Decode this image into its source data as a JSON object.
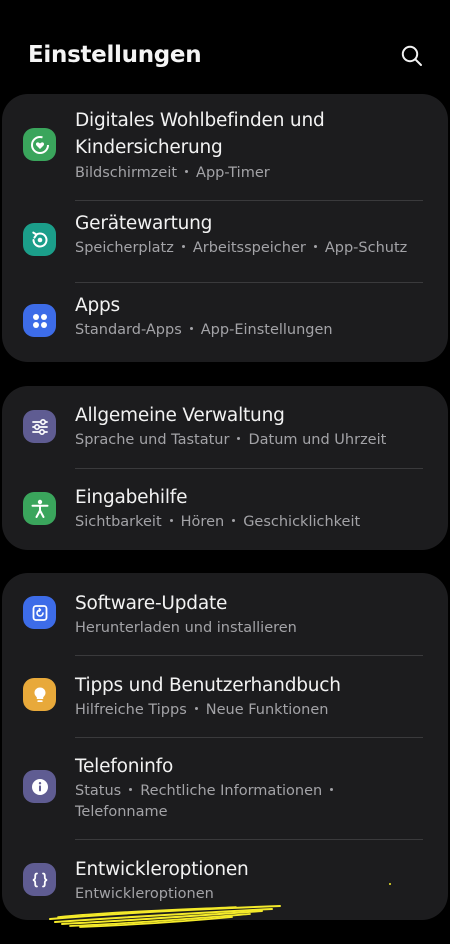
{
  "header": {
    "title": "Einstellungen",
    "search_icon": "search-icon"
  },
  "groups": [
    {
      "items": [
        {
          "title_line1": "Digitales Wohlbefinden und",
          "title_line2": "Kindersicherung",
          "sub": [
            "Bildschirmzeit",
            "App-Timer"
          ],
          "icon": "digital-wellbeing-icon",
          "color": "#3aa55c"
        },
        {
          "title": "Gerätewartung",
          "sub": [
            "Speicherplatz",
            "Arbeitsspeicher",
            "App-Schutz"
          ],
          "icon": "device-care-icon",
          "color": "#1b9e8a"
        },
        {
          "title": "Apps",
          "sub": [
            "Standard-Apps",
            "App-Einstellungen"
          ],
          "icon": "apps-grid-icon",
          "color": "#3d6ce8"
        }
      ]
    },
    {
      "items": [
        {
          "title": "Allgemeine Verwaltung",
          "sub": [
            "Sprache und Tastatur",
            "Datum und Uhrzeit"
          ],
          "icon": "sliders-icon",
          "color": "#5f5c92"
        },
        {
          "title": "Eingabehilfe",
          "sub": [
            "Sichtbarkeit",
            "Hören",
            "Geschicklichkeit"
          ],
          "icon": "accessibility-icon",
          "color": "#3aa55c"
        }
      ]
    },
    {
      "items": [
        {
          "title": "Software-Update",
          "sub": [
            "Herunterladen und installieren"
          ],
          "icon": "software-update-icon",
          "color": "#3d6ce8"
        },
        {
          "title": "Tipps und Benutzerhandbuch",
          "sub": [
            "Hilfreiche Tipps",
            "Neue Funktionen"
          ],
          "icon": "lightbulb-icon",
          "color": "#e8a93a"
        },
        {
          "title": "Telefoninfo",
          "sub_line1": [
            "Status",
            "Rechtliche Informationen"
          ],
          "sub_line2": "Telefonname",
          "icon": "info-icon",
          "color": "#5f5c92"
        },
        {
          "title": "Entwickleroptionen",
          "sub": [
            "Entwickleroptionen"
          ],
          "icon": "developer-braces-icon",
          "color": "#5f5c92"
        }
      ]
    }
  ],
  "colors": {
    "background": "#000000",
    "card": "#1c1c1e",
    "title_text": "#f2f2f2",
    "subtitle_text": "#a3a3a7",
    "divider": "#3a3a3c",
    "scribble": "#f4ea2a"
  }
}
